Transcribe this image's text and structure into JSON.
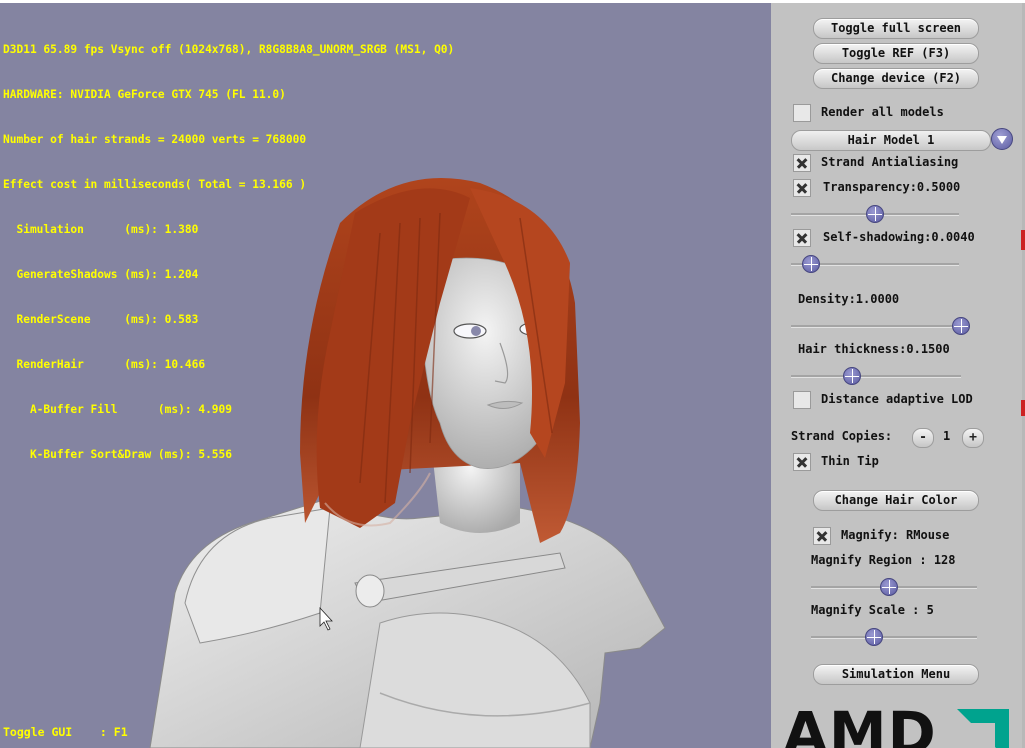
{
  "hud": {
    "lines": [
      "D3D11 65.89 fps Vsync off (1024x768), R8G8B8A8_UNORM_SRGB (MS1, Q0)",
      "HARDWARE: NVIDIA GeForce GTX 745 (FL 11.0)",
      "Number of hair strands = 24000 verts = 768000",
      "Effect cost in milliseconds( Total = 13.166 )",
      "  Simulation      (ms): 1.380",
      "  GenerateShadows (ms): 1.204",
      "  RenderScene     (ms): 0.583",
      "  RenderHair      (ms): 10.466",
      "    A-Buffer Fill      (ms): 4.909",
      "    K-Buffer Sort&Draw (ms): 5.556"
    ],
    "toggle_gui": "Toggle GUI    : F1"
  },
  "panel": {
    "toggle_full_screen": "Toggle full screen",
    "toggle_ref": "Toggle REF (F3)",
    "change_device": "Change device (F2)",
    "render_all_models": {
      "label": "Render all models",
      "checked": false
    },
    "hair_model": {
      "selected": "Hair Model 1"
    },
    "strand_antialiasing": {
      "label": "Strand Antialiasing",
      "checked": true
    },
    "transparency": {
      "label": "Transparency:0.5000",
      "checked": true,
      "value": 0.5
    },
    "self_shadowing": {
      "label": "Self-shadowing:0.0040",
      "checked": true,
      "value": 0.12
    },
    "density": {
      "label": "Density:1.0000",
      "value": 1.0
    },
    "hair_thickness": {
      "label": "Hair thickness:0.1500",
      "value": 0.36
    },
    "distance_adaptive_lod": {
      "label": "Distance adaptive LOD",
      "checked": false
    },
    "strand_copies": {
      "label": "Strand Copies:",
      "minus": "-",
      "value": "1",
      "plus": "+"
    },
    "thin_tip": {
      "label": "Thin Tip",
      "checked": true
    },
    "change_hair_color": "Change Hair Color",
    "magnify": {
      "label": "Magnify: RMouse",
      "checked": true
    },
    "magnify_region": {
      "label": "Magnify Region : 128",
      "value": 0.47
    },
    "magnify_scale": {
      "label": "Magnify Scale : 5",
      "value": 0.38
    },
    "simulation_menu": "Simulation Menu",
    "logo": "AMD"
  },
  "colors": {
    "viewport_bg": "#8484a1",
    "panel_bg": "#c2c2c2",
    "hud_text": "#ffff00",
    "hair": "#a03818",
    "body": "#e2e2e2",
    "logo_green": "#00a38e"
  }
}
